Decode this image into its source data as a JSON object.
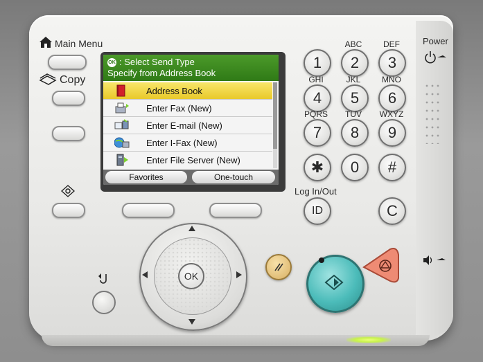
{
  "labels": {
    "main_menu": "Main Menu",
    "copy": "Copy",
    "power": "Power",
    "log_in_out": "Log In/Out",
    "ok": "OK",
    "id": "ID",
    "clear": "C"
  },
  "screen": {
    "header_line1": ": Select Send Type",
    "header_line2": "Specify from Address Book",
    "ok_badge": "OK",
    "items": [
      {
        "label": "Address Book",
        "icon": "address-book-icon",
        "selected": true
      },
      {
        "label": "Enter Fax (New)",
        "icon": "fax-icon",
        "selected": false
      },
      {
        "label": "Enter E-mail (New)",
        "icon": "email-icon",
        "selected": false
      },
      {
        "label": "Enter I-Fax (New)",
        "icon": "ifax-icon",
        "selected": false
      },
      {
        "label": "Enter File Server (New)",
        "icon": "file-server-icon",
        "selected": false
      }
    ],
    "softkeys": [
      "Favorites",
      "One-touch"
    ]
  },
  "keypad": [
    {
      "digit": "1",
      "letters": ""
    },
    {
      "digit": "2",
      "letters": "ABC"
    },
    {
      "digit": "3",
      "letters": "DEF"
    },
    {
      "digit": "4",
      "letters": "GHI"
    },
    {
      "digit": "5",
      "letters": "JKL"
    },
    {
      "digit": "6",
      "letters": "MNO"
    },
    {
      "digit": "7",
      "letters": "PQRS"
    },
    {
      "digit": "8",
      "letters": "TUV"
    },
    {
      "digit": "9",
      "letters": "WXYZ"
    },
    {
      "digit": "✱",
      "letters": ""
    },
    {
      "digit": "0",
      "letters": ""
    },
    {
      "digit": "#",
      "letters": ""
    }
  ],
  "colors": {
    "header_green": "#3a8a1e",
    "selection_yellow": "#f0d63c",
    "start_teal": "#3fb7b5",
    "stop_salmon": "#ef8a74",
    "reset_tan": "#e3c07a"
  }
}
